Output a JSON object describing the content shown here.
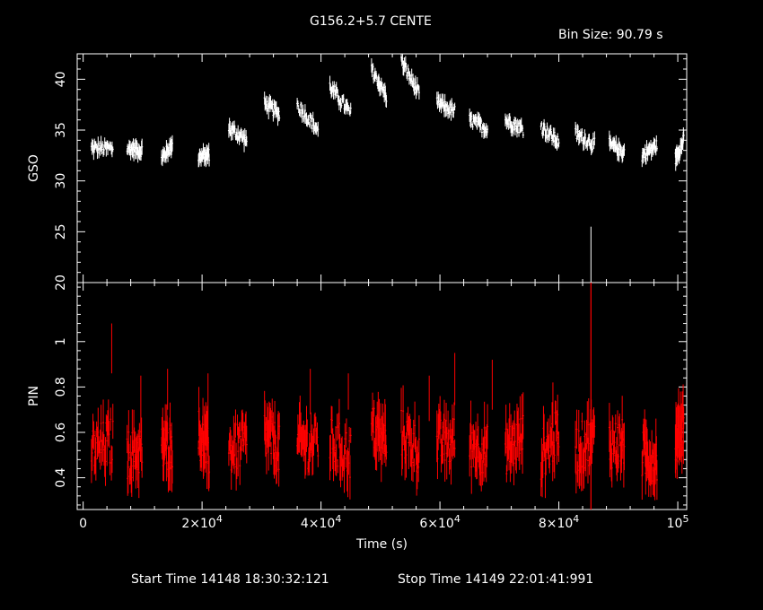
{
  "title": "G156.2+5.7 CENTE",
  "bin_size": "Bin Size: 90.79 s",
  "footer": {
    "start": "Start Time 14148 18:30:32:121",
    "stop": "Stop Time 14149 22:01:41:991"
  },
  "colors": {
    "background": "#000000",
    "axes": "#ffffff",
    "gso": "#ffffff",
    "pin": "#ff0000"
  },
  "chart_data": [
    {
      "panel": "top",
      "type": "scatter",
      "error_bars": true,
      "xlabel": "Time (s)",
      "ylabel": "GSO",
      "xlim": [
        -1000,
        101500
      ],
      "ylim": [
        20,
        42.5
      ],
      "yticks": [
        20,
        25,
        30,
        35,
        40
      ],
      "series": [
        {
          "color": "#ffffff",
          "segments": [
            {
              "x0": 1400,
              "x1": 5000,
              "y0": 33.2,
              "y1": 33.2
            },
            {
              "x0": 7400,
              "x1": 9900,
              "y0": 33.2,
              "y1": 33.0
            },
            {
              "x0": 13200,
              "x1": 15000,
              "y0": 32.2,
              "y1": 33.6
            },
            {
              "x0": 19400,
              "x1": 21200,
              "y0": 32.3,
              "y1": 32.6
            },
            {
              "x0": 24500,
              "x1": 27500,
              "y0": 35.2,
              "y1": 34.0
            },
            {
              "x0": 30500,
              "x1": 33000,
              "y0": 37.6,
              "y1": 36.6
            },
            {
              "x0": 36000,
              "x1": 39500,
              "y0": 37.5,
              "y1": 35.0
            },
            {
              "x0": 41500,
              "x1": 45000,
              "y0": 39.3,
              "y1": 36.6
            },
            {
              "x0": 48500,
              "x1": 51000,
              "y0": 41.0,
              "y1": 38.3
            },
            {
              "x0": 53500,
              "x1": 56500,
              "y0": 41.8,
              "y1": 38.5
            },
            {
              "x0": 59500,
              "x1": 62500,
              "y0": 37.7,
              "y1": 36.8
            },
            {
              "x0": 65000,
              "x1": 68000,
              "y0": 36.0,
              "y1": 35.1
            },
            {
              "x0": 71000,
              "x1": 74000,
              "y0": 36.0,
              "y1": 35.1
            },
            {
              "x0": 77000,
              "x1": 80000,
              "y0": 35.4,
              "y1": 33.8
            },
            {
              "x0": 82800,
              "x1": 86000,
              "y0": 34.6,
              "y1": 33.6
            },
            {
              "x0": 88500,
              "x1": 91000,
              "y0": 33.6,
              "y1": 32.8
            },
            {
              "x0": 94000,
              "x1": 96500,
              "y0": 32.5,
              "y1": 33.5
            },
            {
              "x0": 99600,
              "x1": 101000,
              "y0": 32.2,
              "y1": 34.0
            }
          ],
          "outlier": {
            "x": 85400,
            "y_low": 20.0,
            "y_high": 25.5
          }
        }
      ]
    },
    {
      "panel": "bottom",
      "type": "scatter",
      "error_bars": true,
      "xlabel": "Time (s)",
      "ylabel": "PIN",
      "xlim": [
        -1000,
        101500
      ],
      "ylim": [
        0.26,
        1.26
      ],
      "yticks": [
        0.4,
        0.6,
        0.8,
        1
      ],
      "xticks": [
        0,
        20000,
        40000,
        60000,
        80000,
        100000
      ],
      "xtick_labels": [
        {
          "base": "0",
          "exp": ""
        },
        {
          "base": "2×10",
          "exp": "4"
        },
        {
          "base": "4×10",
          "exp": "4"
        },
        {
          "base": "6×10",
          "exp": "4"
        },
        {
          "base": "8×10",
          "exp": "4"
        },
        {
          "base": "10",
          "exp": "5"
        }
      ],
      "series": [
        {
          "color": "#ff0000",
          "segments": [
            {
              "x0": 1400,
              "x1": 5000,
              "y0": 0.52,
              "y1": 0.56
            },
            {
              "x0": 7400,
              "x1": 9900,
              "y0": 0.5,
              "y1": 0.52
            },
            {
              "x0": 13200,
              "x1": 15000,
              "y0": 0.52,
              "y1": 0.55
            },
            {
              "x0": 19400,
              "x1": 21200,
              "y0": 0.6,
              "y1": 0.5
            },
            {
              "x0": 24500,
              "x1": 27500,
              "y0": 0.52,
              "y1": 0.55
            },
            {
              "x0": 30500,
              "x1": 33000,
              "y0": 0.6,
              "y1": 0.52
            },
            {
              "x0": 36000,
              "x1": 39500,
              "y0": 0.55,
              "y1": 0.55
            },
            {
              "x0": 41500,
              "x1": 45000,
              "y0": 0.56,
              "y1": 0.5
            },
            {
              "x0": 48500,
              "x1": 51000,
              "y0": 0.62,
              "y1": 0.55
            },
            {
              "x0": 53500,
              "x1": 56500,
              "y0": 0.6,
              "y1": 0.52
            },
            {
              "x0": 59500,
              "x1": 62500,
              "y0": 0.55,
              "y1": 0.56
            },
            {
              "x0": 65000,
              "x1": 68000,
              "y0": 0.55,
              "y1": 0.52
            },
            {
              "x0": 71000,
              "x1": 74000,
              "y0": 0.52,
              "y1": 0.58
            },
            {
              "x0": 77000,
              "x1": 80000,
              "y0": 0.5,
              "y1": 0.6
            },
            {
              "x0": 82800,
              "x1": 86000,
              "y0": 0.52,
              "y1": 0.58
            },
            {
              "x0": 88500,
              "x1": 91000,
              "y0": 0.55,
              "y1": 0.55
            },
            {
              "x0": 94000,
              "x1": 96500,
              "y0": 0.5,
              "y1": 0.48
            },
            {
              "x0": 99600,
              "x1": 101000,
              "y0": 0.55,
              "y1": 0.65
            }
          ],
          "outlier": {
            "x": 85400,
            "y_low": 0.26,
            "y_high": 1.26
          },
          "spikes": [
            {
              "x": 4800,
              "y": 0.86,
              "y2": 1.08
            },
            {
              "x": 9700,
              "y": 0.58,
              "y2": 0.85
            },
            {
              "x": 14200,
              "y": 0.7,
              "y2": 0.88
            },
            {
              "x": 21000,
              "y": 0.62,
              "y2": 0.86
            },
            {
              "x": 38200,
              "y": 0.68,
              "y2": 0.88
            },
            {
              "x": 44600,
              "y": 0.7,
              "y2": 0.86
            },
            {
              "x": 58200,
              "y": 0.65,
              "y2": 0.85
            },
            {
              "x": 62500,
              "y": 0.72,
              "y2": 0.95
            },
            {
              "x": 68800,
              "y": 0.7,
              "y2": 0.92
            },
            {
              "x": 79000,
              "y": 0.62,
              "y2": 0.82
            },
            {
              "x": 85400,
              "y": 0.26,
              "y2": 1.26
            }
          ]
        }
      ]
    }
  ]
}
